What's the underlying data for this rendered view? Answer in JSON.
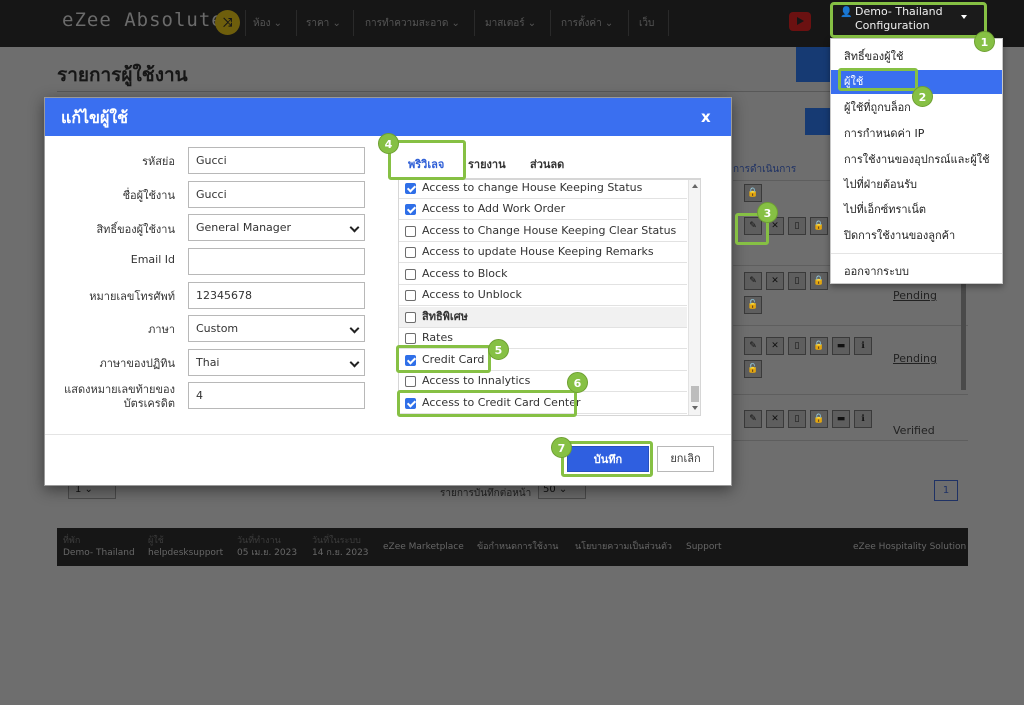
{
  "app": {
    "logo": "eZee Absolute",
    "nav": [
      "ห้อง",
      "ราคา",
      "การทำความสะอาด",
      "มาสเตอร์",
      "การตั้งค่า",
      "เว็บ"
    ],
    "user_menu": {
      "line1": "Demo- Thailand",
      "line2": "Configuration"
    }
  },
  "page": {
    "title": "รายการผู้ใช้งาน",
    "action_column_header": "การดำเนินการ",
    "row_statuses": [
      "Pending",
      "Pending",
      "Verified"
    ],
    "rows_per_page_label": "รายการบันทึกต่อหน้า",
    "rows_per_page": "50",
    "page_select": "1",
    "current_page": "1"
  },
  "footer": {
    "cells": [
      {
        "label": "ที่พัก",
        "value": "Demo- Thailand"
      },
      {
        "label": "ผู้ใช้",
        "value": "helpdesksupport"
      },
      {
        "label": "วันที่ทำงาน",
        "value": "05 เม.ย. 2023"
      },
      {
        "label": "วันที่ในระบบ",
        "value": "14 ก.ย. 2023"
      },
      {
        "label": "",
        "value": "eZee Marketplace"
      },
      {
        "label": "",
        "value": "ข้อกำหนดการใช้งาน"
      },
      {
        "label": "",
        "value": "นโยบายความเป็นส่วนตัว"
      },
      {
        "label": "",
        "value": "Support"
      }
    ],
    "brand": "eZee Hospitality Solution"
  },
  "dropdown": {
    "items": [
      "สิทธิ์ของผู้ใช้",
      "ผู้ใช้",
      "ผู้ใช้ที่ถูกบล็อก",
      "การกำหนดค่า IP",
      "การใช้งานของอุปกรณ์และผู้ใช้",
      "ไปที่ฝ่ายต้อนรับ",
      "ไปที่เอ็กซ์ทราเน็ต",
      "ปิดการใช้งานของลูกค้า",
      "ออกจากระบบ"
    ],
    "active_index": 1
  },
  "modal": {
    "title": "แก้ไขผู้ใช้",
    "close": "x",
    "fields": {
      "short_name": {
        "label": "รหัสย่อ",
        "value": "Gucci"
      },
      "username": {
        "label": "ชื่อผู้ใช้งาน",
        "value": "Gucci"
      },
      "privilege": {
        "label": "สิทธิ์ของผู้ใช้งาน",
        "value": "General Manager"
      },
      "email": {
        "label": "Email Id",
        "value": ""
      },
      "phone": {
        "label": "หมายเลขโทรศัพท์",
        "value": "12345678"
      },
      "language": {
        "label": "ภาษา",
        "value": "Custom"
      },
      "calendar": {
        "label": "ภาษาของปฏิทิน",
        "value": "Thai"
      },
      "card_digits": {
        "label_line1": "แสดงหมายเลขท้ายของ",
        "label_line2": "บัตรเครดิต",
        "value": "4"
      }
    },
    "tabs": [
      "พริวิเลจ",
      "รายงาน",
      "ส่วนลด"
    ],
    "active_tab": 0,
    "permissions": [
      {
        "label": "Access to change House Keeping Status",
        "checked": true,
        "heading": false
      },
      {
        "label": "Access to Add Work Order",
        "checked": true,
        "heading": false
      },
      {
        "label": "Access to Change House Keeping Clear Status",
        "checked": false,
        "heading": false
      },
      {
        "label": "Access to update House Keeping Remarks",
        "checked": false,
        "heading": false
      },
      {
        "label": "Access to Block",
        "checked": false,
        "heading": false
      },
      {
        "label": "Access to Unblock",
        "checked": false,
        "heading": false
      },
      {
        "label": "สิทธิพิเศษ",
        "checked": false,
        "heading": true
      },
      {
        "label": "Rates",
        "checked": false,
        "heading": false
      },
      {
        "label": "Credit Card",
        "checked": true,
        "heading": false
      },
      {
        "label": "Access to Innalytics",
        "checked": false,
        "heading": false
      },
      {
        "label": "Access to Credit Card Center",
        "checked": true,
        "heading": false
      }
    ],
    "save_label": "บันทึก",
    "cancel_label": "ยกเลิก"
  },
  "steps": [
    "1",
    "2",
    "3",
    "4",
    "5",
    "6",
    "7"
  ],
  "colors": {
    "accent": "#3a6ff0",
    "highlight": "#86c044",
    "topbar": "#161616"
  }
}
